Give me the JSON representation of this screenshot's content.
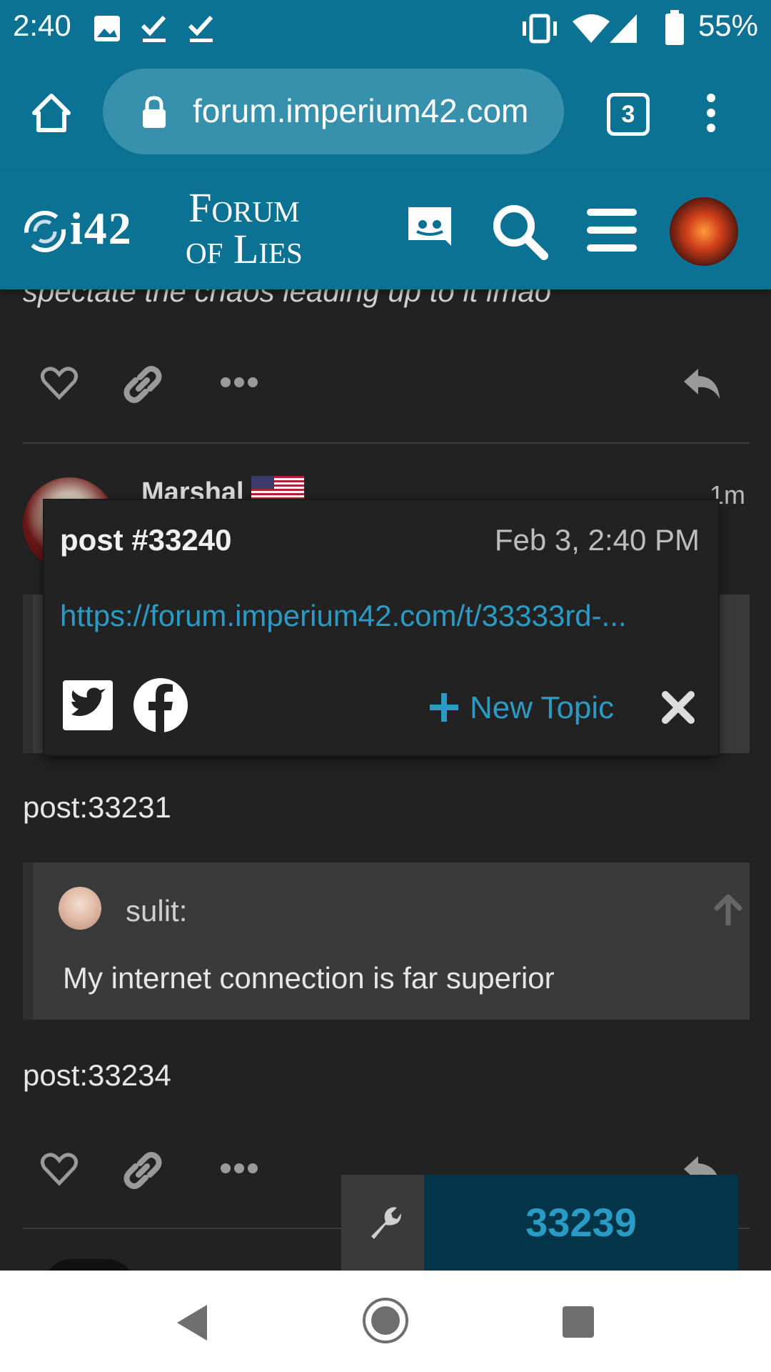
{
  "status_bar": {
    "time": "2:40",
    "battery": "55%"
  },
  "browser": {
    "url": "forum.imperium42.com",
    "tab_count": "3"
  },
  "site": {
    "logo_i42": "i42",
    "logo_line1": "Forum",
    "logo_line2": "of Lies"
  },
  "previous_post": {
    "text_tail": "spectate the chaos leading up to it lmao"
  },
  "post": {
    "username": "Marshal",
    "age": "1m",
    "body_line1": "post:33231",
    "quote": {
      "author": "sulit:",
      "text": "My internet connection is far superior"
    },
    "body_line2": "post:33234"
  },
  "share_popup": {
    "title": "post #33240",
    "date": "Feb 3, 2:40 PM",
    "url": "https://forum.imperium42.com/t/33333rd-...",
    "new_topic_label": "New Topic"
  },
  "progress": {
    "value": "33239"
  },
  "colors": {
    "header": "#0b7294",
    "accent": "#2a9bc5",
    "background": "#222222"
  }
}
